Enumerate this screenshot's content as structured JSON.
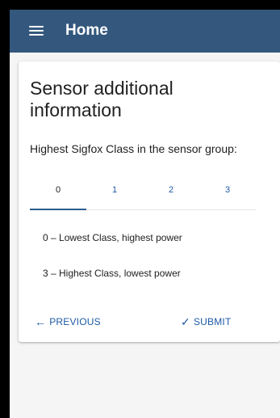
{
  "header": {
    "menu_icon": "menu-icon",
    "title": "Home"
  },
  "card": {
    "heading": "Sensor additional information",
    "question": "Highest Sigfox Class in the sensor group:",
    "tabs": [
      {
        "label": "0",
        "selected": true
      },
      {
        "label": "1",
        "selected": false
      },
      {
        "label": "2",
        "selected": false
      },
      {
        "label": "3",
        "selected": false
      }
    ],
    "notes": [
      "0 – Lowest Class, highest power",
      "3 – Highest Class, lowest power"
    ],
    "previous_label": "PREVIOUS",
    "previous_icon": "arrow-left-icon",
    "submit_label": "SUBMIT",
    "submit_icon": "check-icon"
  },
  "colors": {
    "appbar": "#34587d",
    "accent": "#1e5aa4",
    "tab_indicator": "#2c5b8f"
  }
}
